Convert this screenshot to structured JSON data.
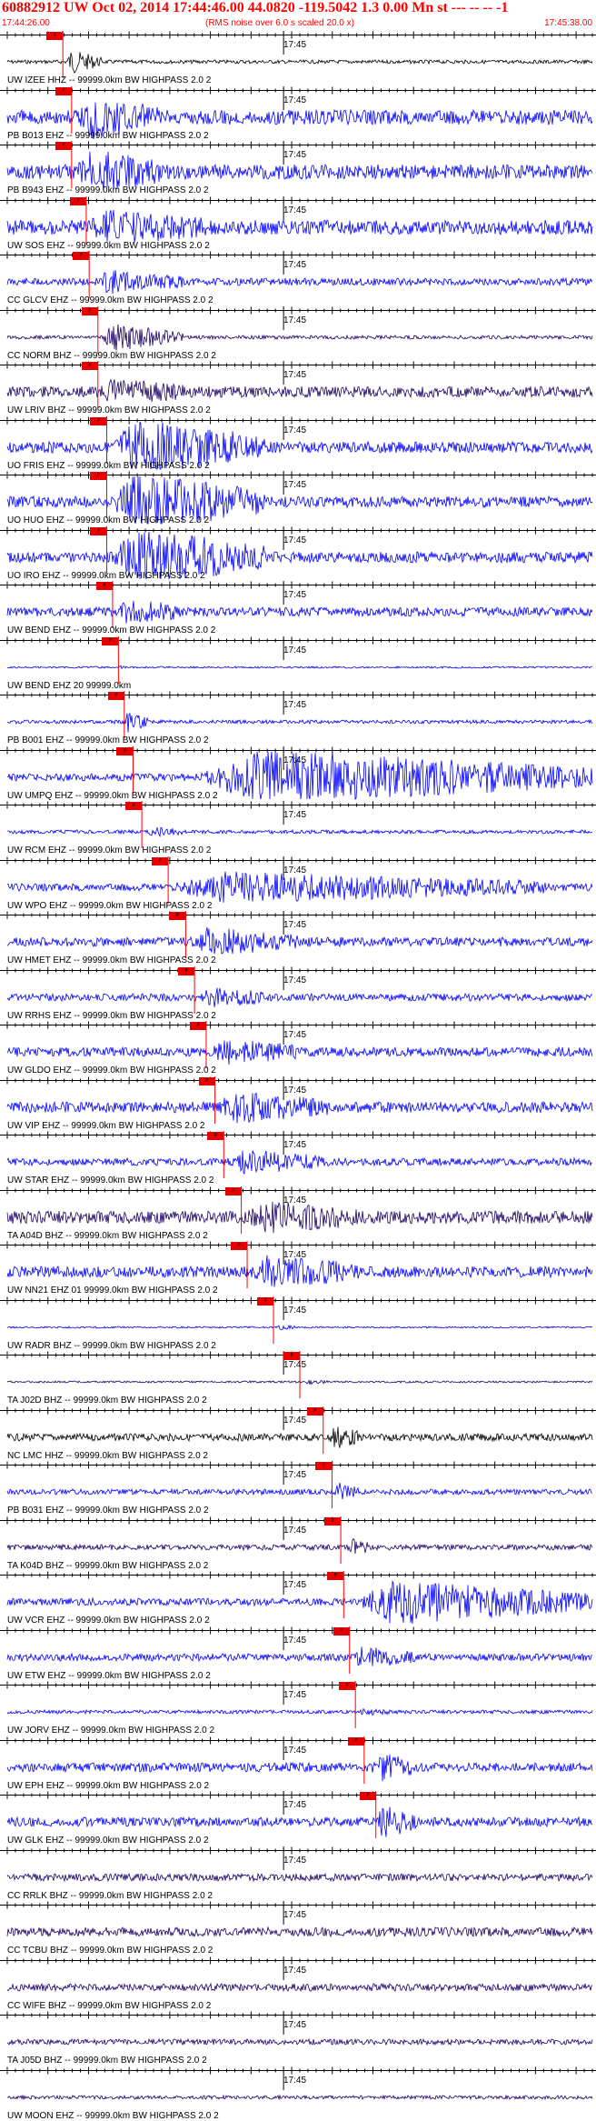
{
  "header": {
    "title": "60882912 UW Oct 02, 2014 17:44:46.00   44.0820 -119.5042  1.3 0.00 Mn st --- -- --  -1",
    "start_time": "17:44:26.00",
    "rms_note": "(RMS noise over 6.0 s scaled 20.0 x)",
    "end_time": "17:45:38.00"
  },
  "minute_label": "17:45",
  "pick_label": "P",
  "colors": {
    "accent": "#ff0000",
    "trace_blue": "#0000ff",
    "trace_dark": "#1a0066",
    "trace_black": "#000000"
  },
  "traces": [
    {
      "label": "UW IZEE HHZ -- 99999.0km BW  HIGHPASS  2.0  2",
      "color": "#000000",
      "amp": 2,
      "pick_frac": 0.095,
      "burst": [
        0.1,
        0.16
      ],
      "burst_amp": 12
    },
    {
      "label": "PB B013 EHZ -- 99999.0km BW  HIGHPASS  2.0  2",
      "color": "#0000ff",
      "amp": 8,
      "pick_frac": 0.11,
      "burst": [
        0.12,
        0.26
      ],
      "burst_amp": 18
    },
    {
      "label": "PB B943 EHZ -- 99999.0km BW  HIGHPASS  2.0  2",
      "color": "#0000ff",
      "amp": 8,
      "pick_frac": 0.11,
      "burst": [
        0.12,
        0.26
      ],
      "burst_amp": 18
    },
    {
      "label": "UW SOS EHZ -- 99999.0km BW  HIGHPASS  2.0  2",
      "color": "#0000ff",
      "amp": 8,
      "pick_frac": 0.135,
      "burst": [
        0.14,
        0.34
      ],
      "burst_amp": 12
    },
    {
      "label": "CC GLCV EHZ -- 99999.0km BW  HIGHPASS  2.0  2",
      "color": "#0000ff",
      "amp": 4,
      "pick_frac": 0.14,
      "burst": [
        0.15,
        0.3
      ],
      "burst_amp": 10
    },
    {
      "label": "CC NORM BHZ -- 99999.0km BW  HIGHPASS  2.0  2",
      "color": "#1a0066",
      "amp": 2,
      "pick_frac": 0.155,
      "burst": [
        0.16,
        0.3
      ],
      "burst_amp": 14
    },
    {
      "label": "UW LRIV BHZ -- 99999.0km BW  HIGHPASS  2.0  2",
      "color": "#1a0066",
      "amp": 6,
      "pick_frac": 0.155,
      "burst": [
        0.16,
        0.3
      ],
      "burst_amp": 10
    },
    {
      "label": "UO FRIS EHZ -- 99999.0km BW  HIGHPASS  2.0  2",
      "color": "#0000ff",
      "amp": 6,
      "pick_frac": 0.17,
      "burst": [
        0.18,
        0.44
      ],
      "burst_amp": 28
    },
    {
      "label": "UO HUO EHZ -- 99999.0km BW  HIGHPASS  2.0  2",
      "color": "#0000ff",
      "amp": 6,
      "pick_frac": 0.17,
      "burst": [
        0.18,
        0.44
      ],
      "burst_amp": 28
    },
    {
      "label": "UO IRO EHZ -- 99999.0km BW  HIGHPASS  2.0  2",
      "color": "#0000ff",
      "amp": 6,
      "pick_frac": 0.17,
      "burst": [
        0.18,
        0.44
      ],
      "burst_amp": 28
    },
    {
      "label": "UW BEND EHZ -- 99999.0km BW  HIGHPASS  2.0  2",
      "color": "#0000ff",
      "amp": 5,
      "pick_frac": 0.18,
      "burst": [
        0.19,
        0.3
      ],
      "burst_amp": 10
    },
    {
      "label": "UW BEND EHZ 20 99999.0km",
      "color": "#0000ff",
      "amp": 1,
      "pick_frac": 0.19,
      "burst": [
        0.19,
        0.2
      ],
      "burst_amp": 1
    },
    {
      "label": "PB B001 EHZ -- 99999.0km BW  HIGHPASS  2.0  2",
      "color": "#0000ff",
      "amp": 2,
      "pick_frac": 0.2,
      "burst": [
        0.2,
        0.24
      ],
      "burst_amp": 10
    },
    {
      "label": "UW UMPQ EHZ -- 99999.0km BW  HIGHPASS  2.0  2",
      "color": "#0000ff",
      "amp": 4,
      "pick_frac": 0.215,
      "burst": [
        0.33,
        1.0
      ],
      "burst_amp": 28
    },
    {
      "label": "UW RCM EHZ -- 99999.0km BW  HIGHPASS  2.0  2",
      "color": "#0000ff",
      "amp": 2,
      "pick_frac": 0.23,
      "burst": [
        0.24,
        0.3
      ],
      "burst_amp": 4
    },
    {
      "label": "UW WPO EHZ -- 99999.0km BW  HIGHPASS  2.0  2",
      "color": "#0000ff",
      "amp": 4,
      "pick_frac": 0.275,
      "burst": [
        0.28,
        0.92
      ],
      "burst_amp": 14
    },
    {
      "label": "UW HMET EHZ -- 99999.0km BW  HIGHPASS  2.0  2",
      "color": "#0000ff",
      "amp": 5,
      "pick_frac": 0.305,
      "burst": [
        0.31,
        0.5
      ],
      "burst_amp": 12
    },
    {
      "label": "UW RRHS EHZ -- 99999.0km BW  HIGHPASS  2.0  2",
      "color": "#0000ff",
      "amp": 4,
      "pick_frac": 0.32,
      "burst": [
        0.33,
        0.45
      ],
      "burst_amp": 8
    },
    {
      "label": "UW GLDO EHZ -- 99999.0km BW  HIGHPASS  2.0  2",
      "color": "#0000ff",
      "amp": 5,
      "pick_frac": 0.34,
      "burst": [
        0.35,
        0.5
      ],
      "burst_amp": 10
    },
    {
      "label": "UW VIP EHZ -- 99999.0km BW  HIGHPASS  2.0  2",
      "color": "#0000ff",
      "amp": 6,
      "pick_frac": 0.355,
      "burst": [
        0.36,
        0.55
      ],
      "burst_amp": 12
    },
    {
      "label": "UW STAR EHZ -- 99999.0km BW  HIGHPASS  2.0  2",
      "color": "#0000ff",
      "amp": 4,
      "pick_frac": 0.37,
      "burst": [
        0.38,
        0.55
      ],
      "burst_amp": 10
    },
    {
      "label": "TA A04D BHZ -- 99999.0km BW  HIGHPASS  2.0  2",
      "color": "#1a0066",
      "amp": 7,
      "pick_frac": 0.4,
      "burst": [
        0.41,
        0.6
      ],
      "burst_amp": 12
    },
    {
      "label": "UW NN21 EHZ 01 99999.0km BW  HIGHPASS  2.0  2",
      "color": "#0000ff",
      "amp": 6,
      "pick_frac": 0.41,
      "burst": [
        0.42,
        0.6
      ],
      "burst_amp": 14
    },
    {
      "label": "UW RADR BHZ -- 99999.0km BW  HIGHPASS  2.0  2",
      "color": "#0000ff",
      "amp": 1,
      "pick_frac": 0.455,
      "burst": [
        0.46,
        0.5
      ],
      "burst_amp": 2
    },
    {
      "label": "TA J02D BHZ -- 99999.0km BW  HIGHPASS  2.0  2",
      "color": "#1a0066",
      "amp": 1,
      "pick_frac": 0.5,
      "burst": [
        0.51,
        0.55
      ],
      "burst_amp": 2
    },
    {
      "label": "NC LMC HHZ -- 99999.0km BW  HIGHPASS  2.0  2",
      "color": "#000000",
      "amp": 4,
      "pick_frac": 0.54,
      "burst": [
        0.55,
        0.6
      ],
      "burst_amp": 12
    },
    {
      "label": "PB B031 EHZ -- 99999.0km BW  HIGHPASS  2.0  2",
      "color": "#0000ff",
      "amp": 3,
      "pick_frac": 0.555,
      "burst": [
        0.56,
        0.6
      ],
      "burst_amp": 8
    },
    {
      "label": "TA K04D BHZ -- 99999.0km BW  HIGHPASS  2.0  2",
      "color": "#1a0066",
      "amp": 3,
      "pick_frac": 0.57,
      "burst": [
        0.58,
        0.62
      ],
      "burst_amp": 8
    },
    {
      "label": "UW VCR EHZ -- 99999.0km BW  HIGHPASS  2.0  2",
      "color": "#0000ff",
      "amp": 4,
      "pick_frac": 0.575,
      "burst": [
        0.6,
        1.0
      ],
      "burst_amp": 22
    },
    {
      "label": "UW ETW EHZ -- 99999.0km BW  HIGHPASS  2.0  2",
      "color": "#0000ff",
      "amp": 4,
      "pick_frac": 0.585,
      "burst": [
        0.59,
        0.7
      ],
      "burst_amp": 8
    },
    {
      "label": "UW JORV EHZ -- 99999.0km BW  HIGHPASS  2.0  2",
      "color": "#0000ff",
      "amp": 2,
      "pick_frac": 0.595,
      "burst": [
        0.6,
        0.65
      ],
      "burst_amp": 4
    },
    {
      "label": "UW EPH EHZ -- 99999.0km BW  HIGHPASS  2.0  2",
      "color": "#0000ff",
      "amp": 5,
      "pick_frac": 0.61,
      "burst": [
        0.62,
        0.7
      ],
      "burst_amp": 12
    },
    {
      "label": "UW GLK EHZ -- 99999.0km BW  HIGHPASS  2.0  2",
      "color": "#0000ff",
      "amp": 5,
      "pick_frac": 0.63,
      "burst": [
        0.63,
        0.7
      ],
      "burst_amp": 14
    },
    {
      "label": "CC RRLK BHZ -- 99999.0km BW  HIGHPASS  2.0  2",
      "color": "#1a0066",
      "amp": 4,
      "pick_frac": null,
      "burst": [
        0,
        0
      ],
      "burst_amp": 0
    },
    {
      "label": "CC TCBU BHZ -- 99999.0km BW  HIGHPASS  2.0  2",
      "color": "#1a0066",
      "amp": 5,
      "pick_frac": null,
      "burst": [
        0,
        0
      ],
      "burst_amp": 0
    },
    {
      "label": "CC WIFE BHZ -- 99999.0km BW  HIGHPASS  2.0  2",
      "color": "#1a0066",
      "amp": 4,
      "pick_frac": null,
      "burst": [
        0,
        0
      ],
      "burst_amp": 0
    },
    {
      "label": "TA J05D BHZ -- 99999.0km BW  HIGHPASS  2.0  2",
      "color": "#1a0066",
      "amp": 3,
      "pick_frac": null,
      "burst": [
        0,
        0
      ],
      "burst_amp": 0
    },
    {
      "label": "UW MOON EHZ -- 99999.0km BW  HIGHPASS  2.0  2",
      "color": "#1a0066",
      "amp": 2,
      "pick_frac": null,
      "burst": [
        0,
        0
      ],
      "burst_amp": 0
    }
  ]
}
